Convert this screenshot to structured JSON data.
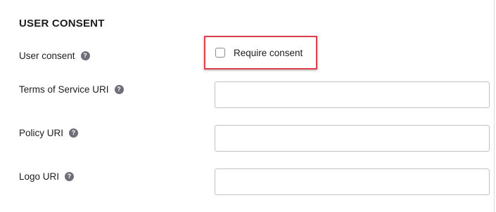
{
  "section": {
    "title": "USER CONSENT"
  },
  "fields": {
    "user_consent": {
      "label": "User consent",
      "help_icon": "?",
      "checkbox_label": "Require consent",
      "checked": false
    },
    "terms_of_service_uri": {
      "label": "Terms of Service URI",
      "help_icon": "?",
      "value": ""
    },
    "policy_uri": {
      "label": "Policy URI",
      "help_icon": "?",
      "value": ""
    },
    "logo_uri": {
      "label": "Logo URI",
      "help_icon": "?",
      "value": ""
    }
  },
  "colors": {
    "highlight_border": "#e2404a",
    "help_icon_bg": "#6e6e78",
    "input_border": "#c1c1c8"
  }
}
